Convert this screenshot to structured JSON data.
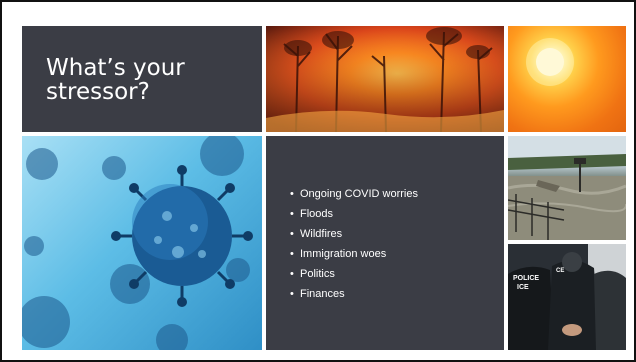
{
  "slide": {
    "title": "What’s your stressor?",
    "bullets": [
      "Ongoing COVID worries",
      "Floods",
      "Wildfires",
      "Immigration woes",
      "Politics",
      "Finances"
    ],
    "bullet_glyph": "•",
    "badge_police": "POLICE",
    "badge_ice": "ICE",
    "badge_ice_partial": "CE",
    "colors": {
      "tile_dark": "#3b3d45",
      "text": "#ffffff",
      "fire_orange": "#ff8a1f",
      "sun_yellow": "#ffd04a",
      "virus_blue": "#2f8fc6"
    }
  }
}
